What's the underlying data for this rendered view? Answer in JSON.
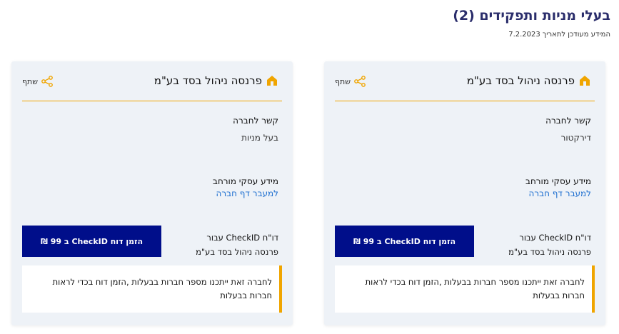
{
  "page": {
    "title": "בעלי מניות ותפקידים (2)",
    "subtitle": "המידע מעודכן לתאריך 7.2.2023"
  },
  "cards": [
    {
      "title": "פרנסה ניהול בסד בע\"מ",
      "share_label": "שתף",
      "relation_label": "קשר לחברה",
      "relation_value": "דירקטור",
      "extended_info_label": "מידע עסקי מורחב",
      "company_link": "למעבר דף חברה",
      "report_line1": "דו\"ח CheckID עבור",
      "report_line2": "פרנסה ניהול בסד בע\"מ",
      "order_button": "הזמן דוח CheckID ב 99 ₪",
      "note_text": "לחברה זאת ייתכנו מספר חברות בבעלות ,הזמן דוח בכדי לראות חברות בבעלות"
    },
    {
      "title": "פרנסה ניהול בסד בע\"מ",
      "share_label": "שתף",
      "relation_label": "קשר לחברה",
      "relation_value": "בעל מניות",
      "extended_info_label": "מידע עסקי מורחב",
      "company_link": "למעבר דף חברה",
      "report_line1": "דו\"ח CheckID עבור",
      "report_line2": "פרנסה ניהול בסד בע\"מ",
      "order_button": "הזמן דוח CheckID ב 99 ₪",
      "note_text": "לחברה זאת ייתכנו מספר חברות בבעלות ,הזמן דוח בכדי לראות חברות בבעלות"
    }
  ],
  "colors": {
    "accent": "#f0a500",
    "button": "#000e8a",
    "title": "#2a2d6b",
    "link": "#1e6fd0",
    "card_bg": "#eef2f7"
  },
  "icons": {
    "header": "building-icon",
    "share": "share-icon"
  }
}
